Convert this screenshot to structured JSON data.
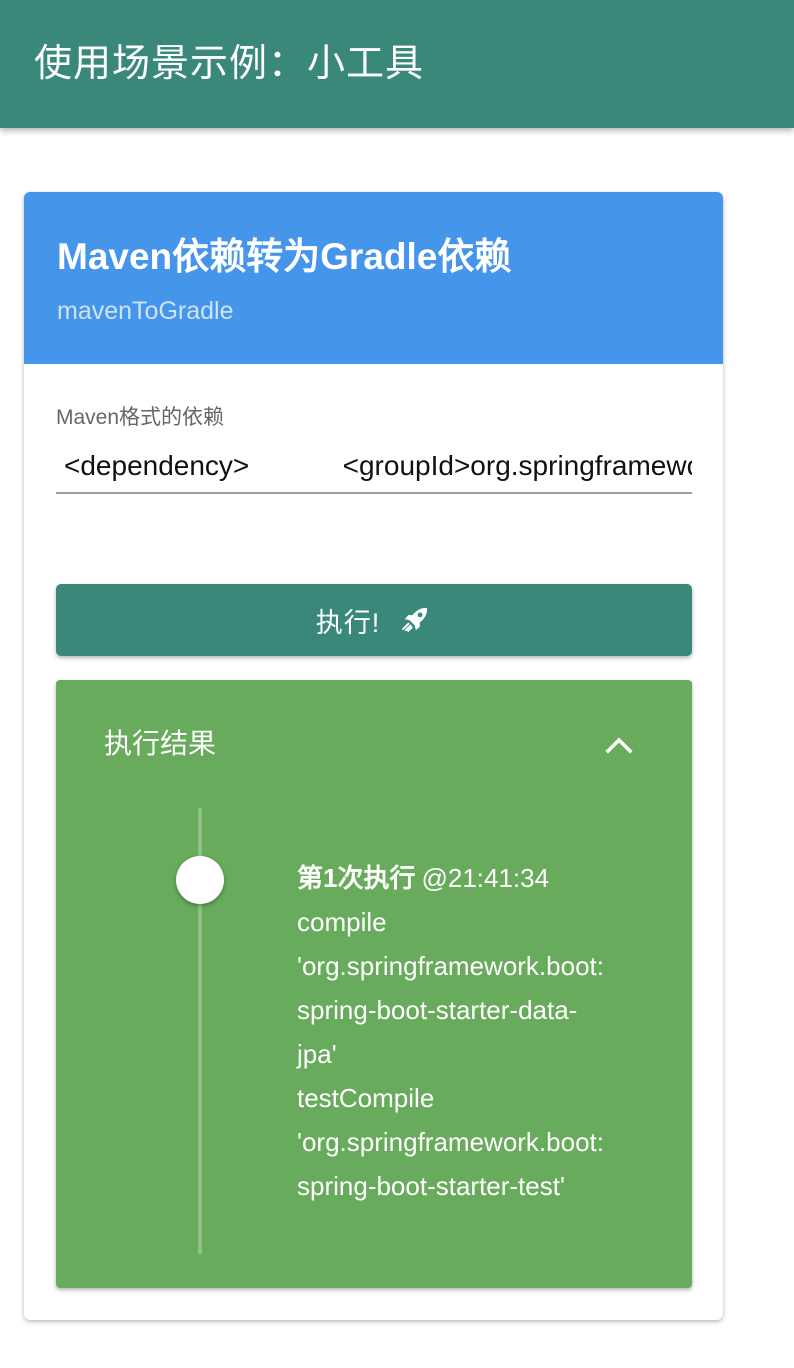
{
  "appbar": {
    "title": "使用场景示例：小工具"
  },
  "card": {
    "title": "Maven依赖转为Gradle依赖",
    "subtitle": "mavenToGradle"
  },
  "input": {
    "label": "Maven格式的依赖",
    "value": "<dependency>            <groupId>org.springframework.boot</groupId>"
  },
  "run_button": {
    "label": "执行!",
    "icon": "rocket-icon"
  },
  "result": {
    "title": "执行结果",
    "toggle_icon": "chevron-up-icon",
    "entries": [
      {
        "run_label": "第1次执行",
        "time": "@21:41:34",
        "lines": [
          "compile",
          "'org.springframework.boot:",
          "spring-boot-starter-data-",
          "jpa'",
          "testCompile",
          "'org.springframework.boot:",
          "spring-boot-starter-test'"
        ]
      }
    ]
  },
  "colors": {
    "appbar": "#3a887a",
    "card_header": "#4596ea",
    "button": "#3a887a",
    "result_panel": "#68ab5c"
  }
}
